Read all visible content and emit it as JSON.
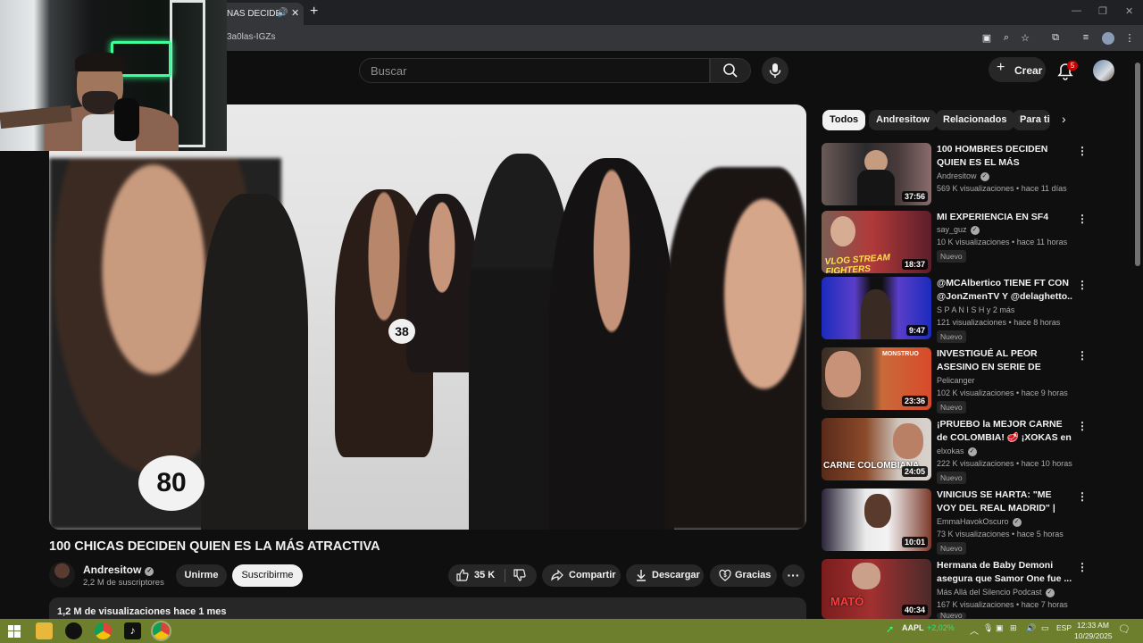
{
  "browser": {
    "tab_title": "ÑAS DECIDEN Q",
    "url_text": "3a0las-IGZs"
  },
  "masthead": {
    "search_placeholder": "Buscar",
    "create_label": "Crear",
    "notifications_count": "5"
  },
  "video": {
    "title": "100 CHICAS DECIDEN QUIEN ES LA MÁS ATRACTIVA",
    "channel": "Andresitow",
    "subscribers": "2,2 M de suscriptores",
    "join_label": "Unirme",
    "subscribe_label": "Suscribirme",
    "likes": "35 K",
    "share_label": "Compartir",
    "download_label": "Descargar",
    "thanks_label": "Gracias",
    "more_label": "···",
    "views_meta": "1,2 M de visualizaciones  hace 1 mes",
    "badge_a": "80",
    "badge_b": "38"
  },
  "chips": [
    "Todos",
    "Andresitow",
    "Relacionados",
    "Para ti"
  ],
  "recommendations": [
    {
      "title": "100 HOMBRES DECIDEN QUIEN ES EL MÁS ATRACTIVO",
      "channel": "Andresitow",
      "meta": "569 K visualizaciones • hace 11 días",
      "duration": "37:56",
      "badge": "",
      "thumb_text": ""
    },
    {
      "title": "MI EXPERIENCIA EN SF4",
      "channel": "say_guz",
      "meta": "10 K visualizaciones • hace 11 horas",
      "duration": "18:37",
      "badge": "Nuevo",
      "thumb_text": "VLOG STREAM FIGHTERS"
    },
    {
      "title": "@MCAlbertico TIENE FT CON @JonZmenTV Y @delaghetto..",
      "channel": "S P A N I S H y 2 más",
      "meta": "121 visualizaciones • hace 8 horas",
      "duration": "9:47",
      "badge": "Nuevo",
      "thumb_text": ""
    },
    {
      "title": "INVESTIGUÉ AL PEOR ASESINO EN SERIE DE COLOMBIA 😨",
      "channel": "Pelicanger",
      "meta": "102 K visualizaciones • hace 9 horas",
      "duration": "23:36",
      "badge": "Nuevo",
      "thumb_text": "MONSTRUO"
    },
    {
      "title": "¡PRUEBO la MEJOR CARNE de COLOMBIA! 🥩 ¡XOKAS en ...",
      "channel": "elxokas",
      "meta": "222 K visualizaciones • hace 10 horas",
      "duration": "24:05",
      "badge": "Nuevo",
      "thumb_text": "CARNE COLOMBIANA"
    },
    {
      "title": "VINICIUS SE HARTA: \"ME VOY DEL REAL MADRID\" | ADIÓS ...",
      "channel": "EmmaHavokOscuro",
      "meta": "73 K visualizaciones • hace 5 horas",
      "duration": "10:01",
      "badge": "Nuevo",
      "thumb_text": ""
    },
    {
      "title": "Hermana de Baby Demoni asegura que Samor One fue ...",
      "channel": "Más Allá del Silencio Podcast",
      "meta": "167 K visualizaciones • hace 7 horas",
      "duration": "40:34",
      "badge": "Nuevo",
      "thumb_text": "MATÓ"
    }
  ],
  "taskbar": {
    "stock": "AAPL",
    "stock_change": "+2,02%",
    "lang": "ESP",
    "time": "12:33 AM",
    "date": "10/29/2025"
  },
  "colors": {
    "bg": "#0f0f0f",
    "chip": "#272727",
    "notification": "#cc0000",
    "taskbar": "#6d7f2c",
    "webcam_led": "#3dff9a"
  }
}
